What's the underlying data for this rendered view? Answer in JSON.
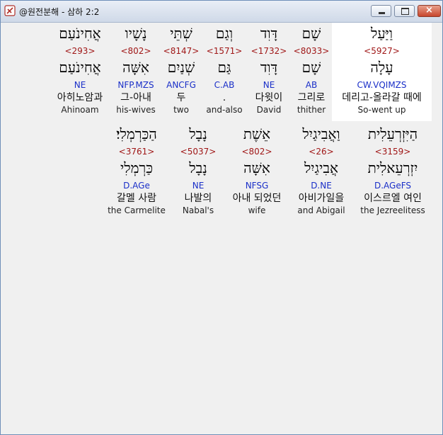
{
  "window": {
    "title": "@원전분해 - 삼하 2:2",
    "minimize": "",
    "maximize": "",
    "close": "×"
  },
  "row1": [
    {
      "heb": "וַיַּעַל",
      "strong": "<5927>",
      "lemma": "עָלָה",
      "parse": "CW.VQIMZS",
      "kor": "데리고-올라갈 때에",
      "eng": "So-went up"
    },
    {
      "heb": "שָׁם",
      "strong": "<8033>",
      "lemma": "שָׁם",
      "parse": "AB",
      "kor": "그리로",
      "eng": "thither"
    },
    {
      "heb": "דָּוִד",
      "strong": "<1732>",
      "lemma": "דָּוִד",
      "parse": "NE",
      "kor": "다윗이",
      "eng": "David"
    },
    {
      "heb": "וְגַם",
      "strong": "<1571>",
      "lemma": "גַּם",
      "parse": "C.AB",
      "kor": ".",
      "eng": "and-also"
    },
    {
      "heb": "שְׁתֵּי",
      "strong": "<8147>",
      "lemma": "שְׁנַיִם",
      "parse": "ANCFG",
      "kor": "두",
      "eng": "two"
    },
    {
      "heb": "נָשָׁיו",
      "strong": "<802>",
      "lemma": "אִשָּׁה",
      "parse": "NFP.MZS",
      "kor": "그-아내",
      "eng": "his-wives"
    },
    {
      "heb": "אֲחִינֹעַם",
      "strong": "<293>",
      "lemma": "אֲחִינֹעַם",
      "parse": "NE",
      "kor": "아히노암과",
      "eng": "Ahinoam"
    }
  ],
  "row2": [
    {
      "heb": "הַיִּזְרְעֵלִית",
      "strong": "<3159>",
      "lemma": "יִזְרְעֵאלִית",
      "parse": "D.AGeFS",
      "kor": "이스르엘 여인",
      "eng": "the Jezreelitess"
    },
    {
      "heb": "וַאֲבִיגַיִל",
      "strong": "<26>",
      "lemma": "אֲבִיגַיִל",
      "parse": "D.NE",
      "kor": "아비가일을",
      "eng": "and Abigail"
    },
    {
      "heb": "אֵשֶׁת",
      "strong": "<802>",
      "lemma": "אִשָּׁה",
      "parse": "NFSG",
      "kor": "아내 되었던",
      "eng": "wife"
    },
    {
      "heb": "נָבָל",
      "strong": "<5037>",
      "lemma": "נָבָל",
      "parse": "NE",
      "kor": "나발의",
      "eng": "Nabal's"
    },
    {
      "heb": "הַכַּרְמְלִי׃",
      "strong": "<3761>",
      "lemma": "כַּרְמְלִי",
      "parse": "D.AGe",
      "kor": "갈멜 사람",
      "eng": "the Carmelite"
    }
  ]
}
